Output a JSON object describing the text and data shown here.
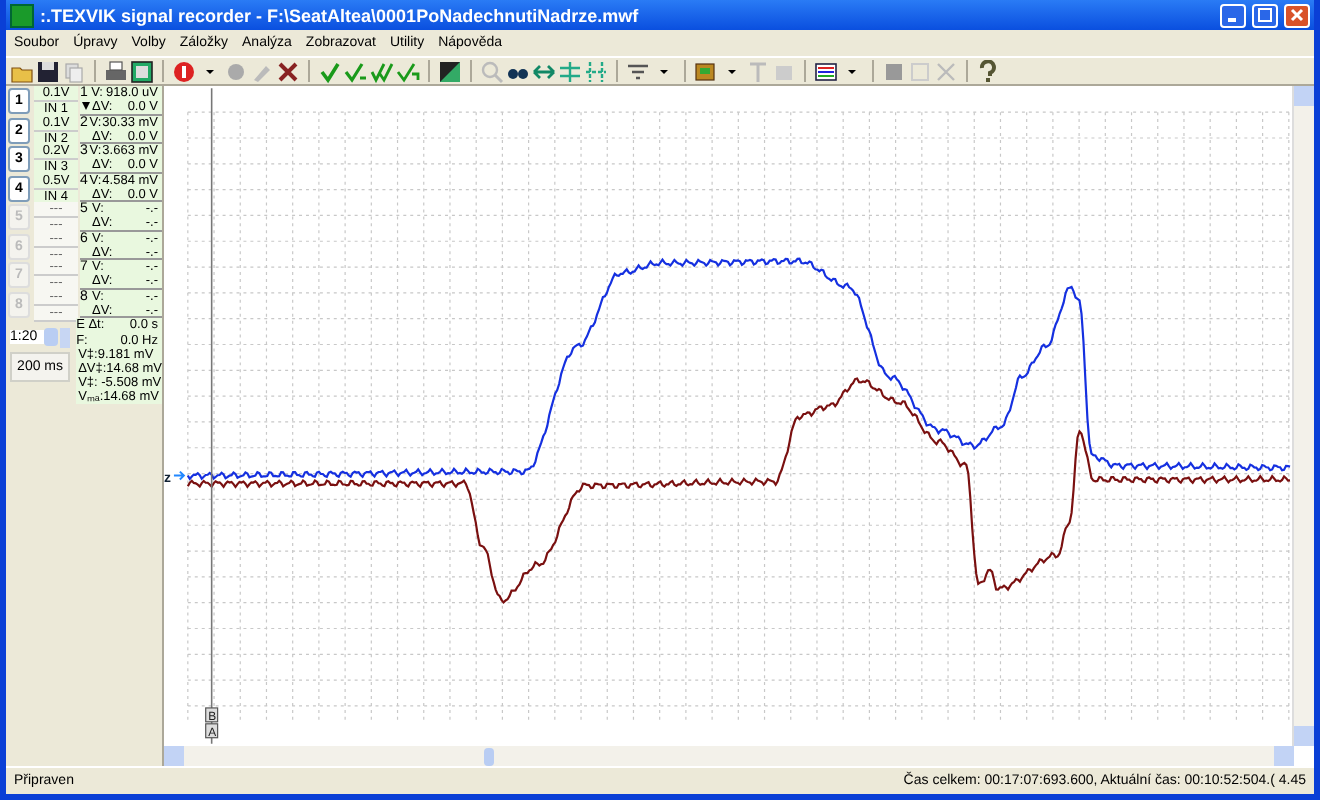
{
  "window": {
    "title": ":.TEXVIK  signal recorder - F:\\SeatAltea\\0001PoNadechnutiNadrze.mwf"
  },
  "menu": [
    "Soubor",
    "Úpravy",
    "Volby",
    "Záložky",
    "Analýza",
    "Zobrazovat",
    "Utility",
    "Nápověda"
  ],
  "channels": [
    {
      "button": "1",
      "number": "1",
      "scale": "0.1V",
      "input": "IN 1",
      "enabled": true,
      "active": true,
      "v_label": "V:",
      "v": "918.0 uV",
      "dv_label": "ΔV:",
      "dv": "0.0 V"
    },
    {
      "button": "2",
      "number": "2",
      "scale": "0.1V",
      "input": "IN 2",
      "enabled": true,
      "active": false,
      "v_label": "V:",
      "v": "30.33 mV",
      "dv_label": "ΔV:",
      "dv": "0.0 V"
    },
    {
      "button": "3",
      "number": "3",
      "scale": "0.2V",
      "input": "IN 3",
      "enabled": true,
      "active": false,
      "v_label": "V:",
      "v": "3.663 mV",
      "dv_label": "ΔV:",
      "dv": "0.0 V"
    },
    {
      "button": "4",
      "number": "4",
      "scale": "0.5V",
      "input": "IN 4",
      "enabled": true,
      "active": false,
      "v_label": "V:",
      "v": "4.584 mV",
      "dv_label": "ΔV:",
      "dv": "0.0 V"
    },
    {
      "button": "5",
      "number": "5",
      "scale": "---",
      "input": "---",
      "enabled": false,
      "active": false,
      "v_label": "V:",
      "v": "-.-",
      "dv_label": "ΔV:",
      "dv": "-.-"
    },
    {
      "button": "6",
      "number": "6",
      "scale": "---",
      "input": "---",
      "enabled": false,
      "active": false,
      "v_label": "V:",
      "v": "-.-",
      "dv_label": "ΔV:",
      "dv": "-.-"
    },
    {
      "button": "7",
      "number": "7",
      "scale": "---",
      "input": "---",
      "enabled": false,
      "active": false,
      "v_label": "V:",
      "v": "-.-",
      "dv_label": "ΔV:",
      "dv": "-.-"
    },
    {
      "button": "8",
      "number": "8",
      "scale": "---",
      "input": "---",
      "enabled": false,
      "active": false,
      "v_label": "V:",
      "v": "-.-",
      "dv_label": "ΔV:",
      "dv": "-.-"
    }
  ],
  "timebase": {
    "ratio": "1:20",
    "window": "200 ms"
  },
  "measurements": [
    {
      "label": "E Δt:",
      "value": "0.0 s"
    },
    {
      "label": "F:",
      "value": "0.0 Hz"
    }
  ],
  "cursor_values": [
    "V‡:9.181 mV",
    "ΔV‡:14.68 mV",
    "V‡: -5.508 mV",
    "Vₘₐ:14.68 mV"
  ],
  "plot": {
    "zero_label": "z",
    "cursor_labels": [
      "B",
      "A"
    ]
  },
  "status_bar": {
    "left": "Připraven",
    "right": "Čas celkem: 00:17:07:693.600, Aktuální čas: 00:10:52:504.( 4.45"
  }
}
